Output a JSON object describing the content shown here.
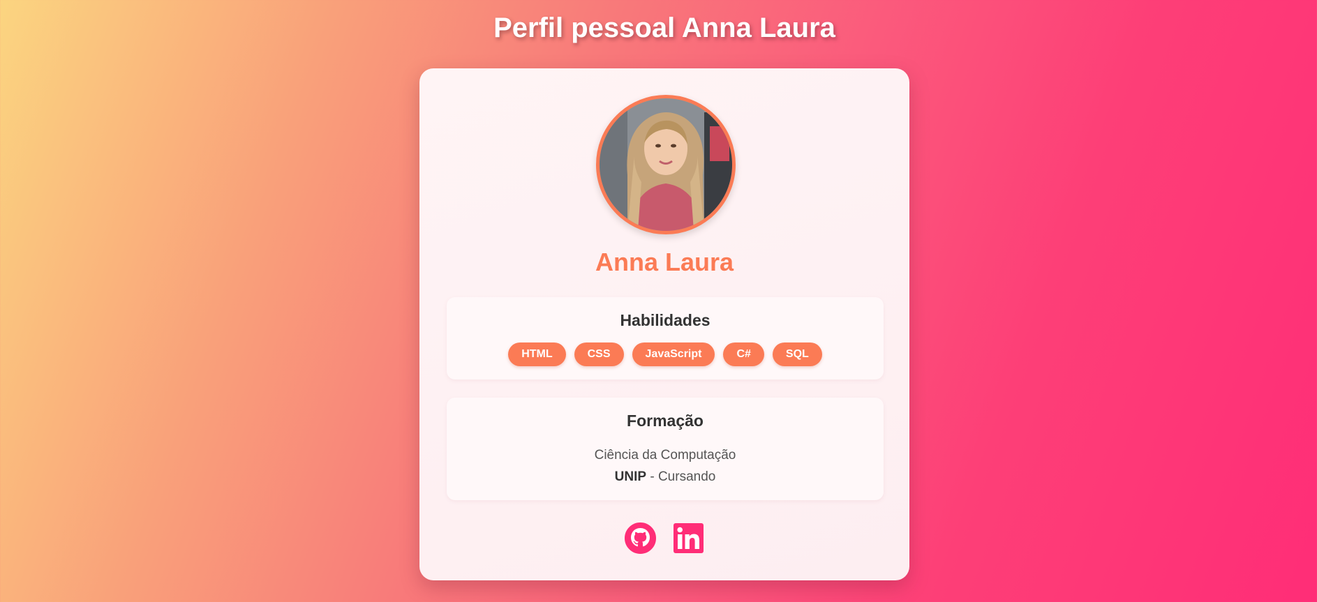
{
  "header": {
    "title": "Perfil pessoal Anna Laura"
  },
  "profile": {
    "name": "Anna Laura",
    "avatar_icon": "profile-photo"
  },
  "skills": {
    "title": "Habilidades",
    "items": [
      "HTML",
      "CSS",
      "JavaScript",
      "C#",
      "SQL"
    ]
  },
  "education": {
    "title": "Formação",
    "course": "Ciência da Computação",
    "school": "UNIP",
    "status": "- Cursando"
  },
  "social": {
    "github_icon": "github-icon",
    "linkedin_icon": "linkedin-icon",
    "icon_color": "#ff2d77"
  },
  "colors": {
    "accent": "#fb7b55",
    "social": "#ff2d77"
  }
}
